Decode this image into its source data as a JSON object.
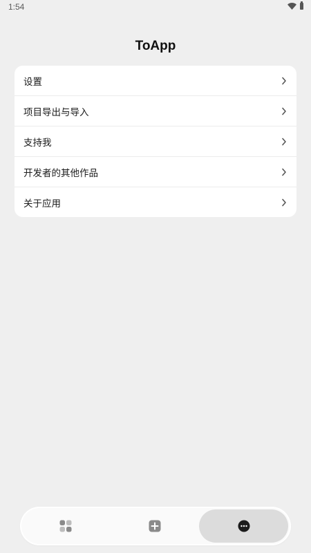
{
  "status_bar": {
    "time": "1:54",
    "wifi_icon": "wifi-icon",
    "battery_icon": "battery-icon"
  },
  "header": {
    "title": "ToApp"
  },
  "menu": {
    "items": [
      {
        "label": "设置",
        "icon": "chevron-right-icon"
      },
      {
        "label": "项目导出与导入",
        "icon": "chevron-right-icon"
      },
      {
        "label": "支持我",
        "icon": "chevron-right-icon"
      },
      {
        "label": "开发者的其他作品",
        "icon": "chevron-right-icon"
      },
      {
        "label": "关于应用",
        "icon": "chevron-right-icon"
      }
    ]
  },
  "bottom_nav": {
    "tabs": [
      {
        "icon": "apps-grid-icon",
        "active": false
      },
      {
        "icon": "add-square-icon",
        "active": false
      },
      {
        "icon": "more-circle-icon",
        "active": true
      }
    ]
  },
  "colors": {
    "background": "#efefef",
    "card": "#ffffff",
    "active_tab": "#dcdcdc",
    "icon_gray": "#8a8a8a",
    "icon_dark": "#1b1b1b"
  }
}
